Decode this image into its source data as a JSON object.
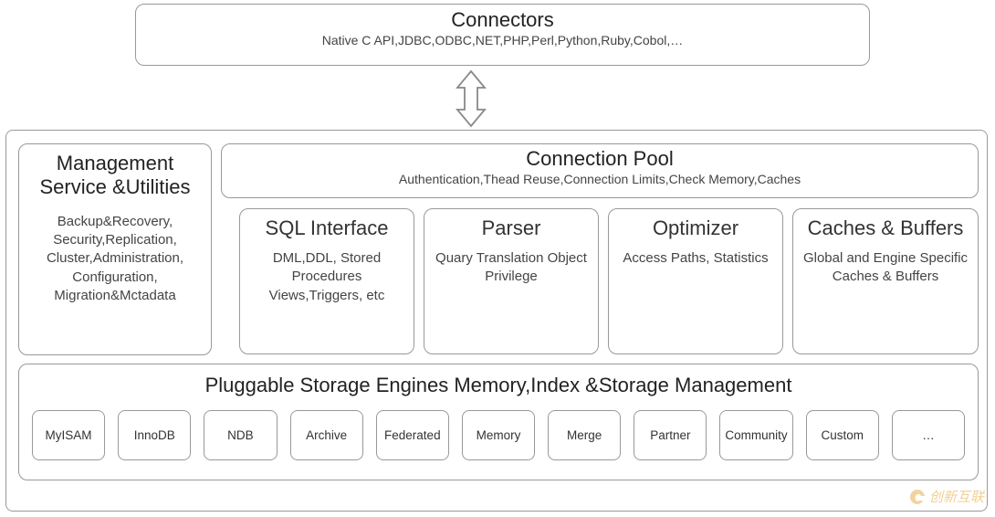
{
  "connectors": {
    "title": "Connectors",
    "subtitle": "Native C API,JDBC,ODBC,NET,PHP,Perl,Python,Ruby,Cobol,…"
  },
  "management": {
    "title": "Management Service &Utilities",
    "detail": "Backup&Recovery, Security,Replication, Cluster,Administration, Configuration, Migration&Mctadata"
  },
  "connection_pool": {
    "title": "Connection Pool",
    "subtitle": "Authentication,Thead Reuse,Connection Limits,Check Memory,Caches"
  },
  "sql_interface": {
    "title": "SQL Interface",
    "detail": "DML,DDL, Stored Procedures Views,Triggers, etc"
  },
  "parser": {
    "title": "Parser",
    "detail": "Quary Translation Object Privilege"
  },
  "optimizer": {
    "title": "Optimizer",
    "detail": "Access Paths, Statistics"
  },
  "caches": {
    "title": "Caches & Buffers",
    "detail": "Global and Engine Specific Caches & Buffers"
  },
  "storage": {
    "title": "Pluggable Storage Engines Memory,Index &Storage Management",
    "engines": [
      "MyISAM",
      "InnoDB",
      "NDB",
      "Archive",
      "Federated",
      "Memory",
      "Merge",
      "Partner",
      "Community",
      "Custom",
      "…"
    ]
  },
  "watermark": "创新互联"
}
